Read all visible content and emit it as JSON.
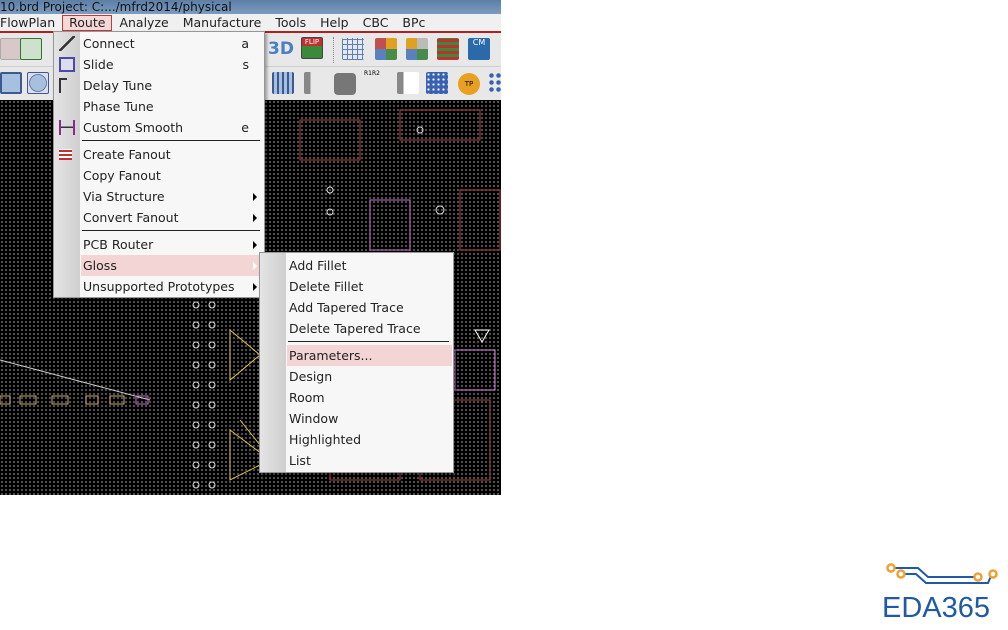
{
  "window": {
    "title": "10.brd  Project: C:.../mfrd2014/physical"
  },
  "menubar": [
    "FlowPlan",
    "Route",
    "Analyze",
    "Manufacture",
    "Tools",
    "Help",
    "CBC",
    "BPc"
  ],
  "route_menu": {
    "items": [
      {
        "label": "Connect",
        "shortcut": "a",
        "icon": "connect-icon"
      },
      {
        "label": "Slide",
        "shortcut": "s",
        "icon": "slide-icon"
      },
      {
        "label": "Delay Tune",
        "icon": "delay-tune-icon"
      },
      {
        "label": "Phase Tune"
      },
      {
        "label": "Custom Smooth",
        "shortcut": "e",
        "icon": "custom-smooth-icon"
      },
      {
        "label": "Create Fanout",
        "icon": "create-fanout-icon"
      },
      {
        "label": "Copy Fanout"
      },
      {
        "label": "Via Structure",
        "submenu": true
      },
      {
        "label": "Convert Fanout",
        "submenu": true
      },
      {
        "label": "PCB Router",
        "submenu": true
      },
      {
        "label": "Gloss",
        "submenu": true,
        "highlighted": true
      },
      {
        "label": "Unsupported Prototypes",
        "submenu": true
      }
    ]
  },
  "gloss_submenu": {
    "items": [
      {
        "label": "Add Fillet"
      },
      {
        "label": "Delete Fillet"
      },
      {
        "label": "Add Tapered Trace"
      },
      {
        "label": "Delete Tapered Trace"
      },
      {
        "label": "Parameters...",
        "highlighted": true
      },
      {
        "label": "Design"
      },
      {
        "label": "Room"
      },
      {
        "label": "Window"
      },
      {
        "label": "Highlighted"
      },
      {
        "label": "List"
      }
    ]
  },
  "toolbar": {
    "flip_label": "FLIP",
    "threed_label": "3D",
    "cm_label": "CM",
    "tp_label": "TP",
    "r1r2_label": "R1R2"
  },
  "logo": {
    "text": "EDA365"
  },
  "colors": {
    "accent": "#b02020",
    "highlight": "#f3d5d5",
    "logo_blue": "#1e5aa8",
    "logo_orange": "#f0a030"
  }
}
